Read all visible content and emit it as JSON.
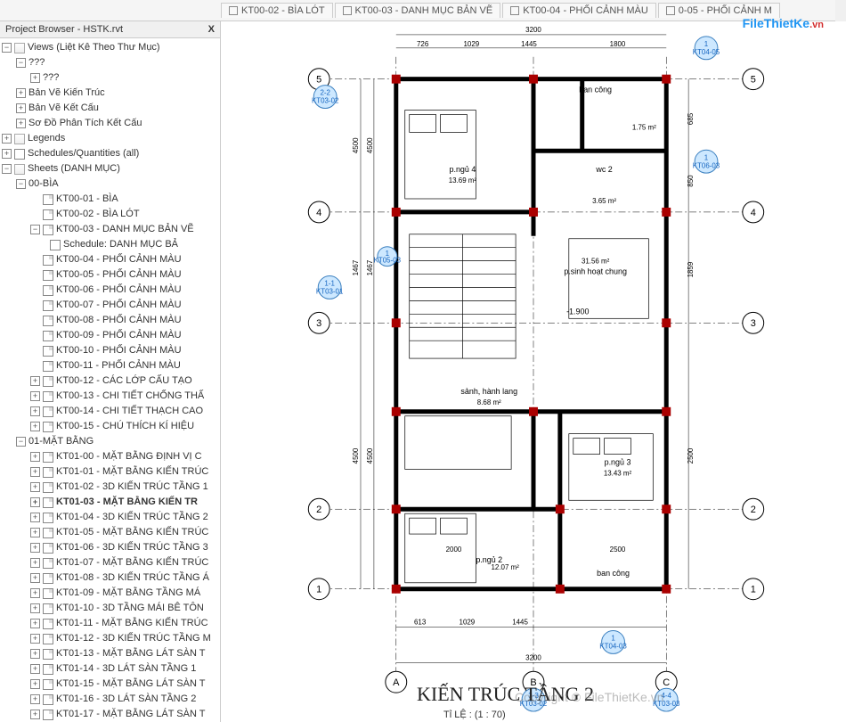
{
  "browser": {
    "title": "Project Browser - HSTK.rvt",
    "close": "X",
    "views_root": "Views (Liệt Kê Theo Thư Mục)",
    "unknown": "???",
    "items": {
      "bvkt": "Bản Vẽ Kiến Trúc",
      "bvkc": "Bản Vẽ Kết Cấu",
      "sdptkc": "Sơ Đồ Phân Tích Kết Cấu",
      "legends": "Legends",
      "schedules": "Schedules/Quantities (all)",
      "sheets": "Sheets (DANH MỤC)",
      "bia00": "00-BÌA",
      "matbang01": "01-MẶT BẰNG"
    },
    "sheets_bia": [
      "KT00-01 - BÌA",
      "KT00-02 - BÌA LÓT",
      "KT00-03 - DANH MỤC BẢN VẼ",
      "KT00-04 - PHỐI CẢNH MÀU",
      "KT00-05 - PHỐI CẢNH MÀU",
      "KT00-06 - PHỐI CẢNH MÀU",
      "KT00-07 - PHỐI CẢNH MÀU",
      "KT00-08 - PHỐI CẢNH MÀU",
      "KT00-09 - PHỐI CẢNH MÀU",
      "KT00-10 - PHỐI CẢNH MÀU",
      "KT00-11 - PHỐI CẢNH MÀU",
      "KT00-12 - CÁC LỚP CẤU TẠO",
      "KT00-13 - CHI TIẾT CHỐNG THẤ",
      "KT00-14 - CHI TIẾT THẠCH CAO",
      "KT00-15 - CHÚ THÍCH KÍ HIỆU"
    ],
    "schedule_item": "Schedule: DANH MỤC BẢ",
    "sheets_mb": [
      "KT01-00 - MẶT BẰNG ĐỊNH VỊ C",
      "KT01-01 - MẶT BẰNG KIẾN TRÚC",
      "KT01-02 - 3D KIẾN TRÚC TẦNG 1",
      "KT01-03 - MẶT BẰNG KIẾN TR",
      "KT01-04 - 3D KIẾN TRÚC TẦNG 2",
      "KT01-05 - MẶT BẰNG KIẾN TRÚC",
      "KT01-06 - 3D KIẾN TRÚC TẦNG 3",
      "KT01-07 - MẶT BẰNG KIẾN TRÚC",
      "KT01-08 - 3D KIẾN TRÚC TẦNG Á",
      "KT01-09 - MẶT BẰNG TẦNG MÁ",
      "KT01-10 - 3D TẦNG MÁI BÊ TÔN",
      "KT01-11 - MẶT BẰNG KIẾN TRÚC",
      "KT01-12 - 3D KIẾN TRÚC TẦNG M",
      "KT01-13 - MẶT BẰNG LÁT SÀN T",
      "KT01-14 - 3D LÁT SÀN TẦNG 1",
      "KT01-15 - MẶT BẰNG LÁT SÀN T",
      "KT01-16 - 3D LÁT SÀN TẦNG 2",
      "KT01-17 - MẶT BẰNG LÁT SÀN T"
    ],
    "selected_index": 3
  },
  "tabs": [
    "KT00-02 - BÌA LÓT",
    "KT00-03 - DANH MỤC BẢN VẼ",
    "KT00-04 - PHỐI CẢNH MÀU",
    "0-05 - PHỐI CẢNH M"
  ],
  "logo": {
    "main": "FileThietKe",
    "suffix": ".vn"
  },
  "drawing": {
    "title": "KIẾN TRÚC TẦNG 2",
    "scale": "Tỉ LỆ : (1 : 70)",
    "watermark": "Copyright © FileThietKe.vn",
    "grids_h": [
      "1",
      "2",
      "3",
      "4",
      "5"
    ],
    "grids_v": [
      "A",
      "B",
      "C"
    ],
    "sections": {
      "s1": "1-1",
      "s2": "2-2",
      "s3": "3-3",
      "s4": "4-4",
      "kt0301": "KT03-01",
      "kt0302": "KT03-02",
      "kt0303": "KT03-03",
      "kt0403": "KT04-03",
      "kt0405": "KT04-05",
      "kt0503": "KT05-03",
      "kt0603": "KT06-03",
      "one": "1"
    },
    "rooms": {
      "pngu2": {
        "name": "p.ngủ 2",
        "area": "12.07 m²"
      },
      "pngu3": {
        "name": "p.ngủ 3",
        "area": "13.43 m²"
      },
      "pngu4": {
        "name": "p.ngủ 4",
        "area": "13.69 m²"
      },
      "sanh": {
        "name": "sảnh, hành lang",
        "area": "8.68 m²"
      },
      "psinh": {
        "name": "p.sinh hoạt chung",
        "area": "31.56 m²"
      },
      "wc2": {
        "name": "wc 2",
        "area": "3.65 m²"
      },
      "bancong1": "ban công",
      "bancong2": "ban công",
      "small": "1.75 m²"
    },
    "level": "-1.900",
    "dims": {
      "top_total": "3200",
      "top1": "726",
      "top2": "1029",
      "top3": "1445",
      "top4": "1800",
      "left1": "4500",
      "left2": "1467",
      "left3": "4500",
      "left_a": "4500",
      "left_b": "1467",
      "left_c": "4500",
      "right1": "685",
      "right2": "1859",
      "right3": "850",
      "right4": "2500",
      "bot_total": "3200",
      "bot1": "613",
      "bot2": "1029",
      "bot3": "1445",
      "v2000": "2000",
      "v2500": "2500",
      "v1800": "1800"
    }
  }
}
